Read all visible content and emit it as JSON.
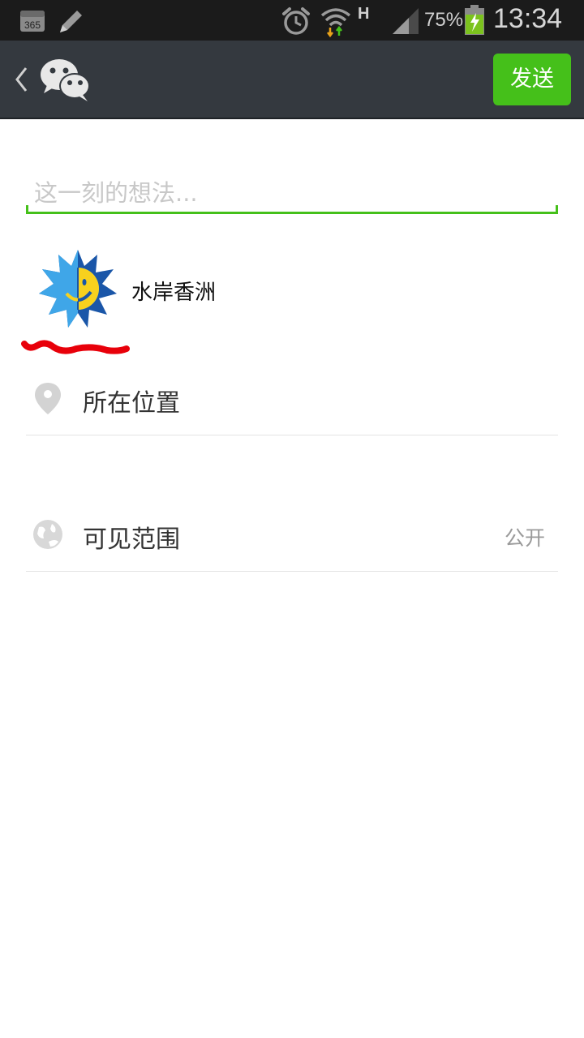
{
  "status_bar": {
    "battery_percent": "75%",
    "time": "13:34",
    "network_type": "H",
    "calendar_day": "365",
    "icons": [
      "calendar-icon",
      "pencil-icon",
      "alarm-icon",
      "wifi-icon",
      "signal-icon",
      "battery-charging-icon"
    ]
  },
  "header": {
    "back_icon": "chevron-left-icon",
    "logo_icon": "wechat-logo-icon",
    "send_label": "发送"
  },
  "composer": {
    "placeholder": "这一刻的想法..."
  },
  "user": {
    "name": "水岸香洲"
  },
  "options": [
    {
      "label": "所在位置",
      "icon": "location-pin-icon"
    },
    {
      "label": "可见范围",
      "value": "公开",
      "icon": "globe-icon"
    }
  ],
  "colors": {
    "accent": "#45c01a",
    "action_bar": "#34393f",
    "status_bar": "#1b1b1b",
    "scribble": "#e8000a"
  }
}
